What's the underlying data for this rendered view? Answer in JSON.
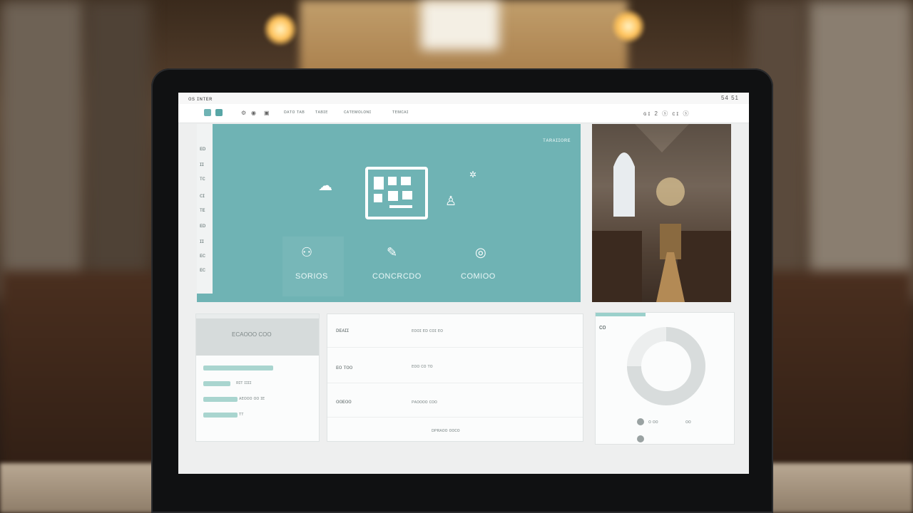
{
  "titlebar": {
    "title": "os ɪɴᴛᴇʀ",
    "right": "54 51"
  },
  "nav": {
    "links": [
      "ᴅᴀᴛᴏ ᴛᴀʙ",
      "ᴛᴀʙɪᴇ",
      "ᴄᴀᴛᴇᴍᴏʟᴏɴɪ",
      "ᴛᴇᴍᴄᴀɪ"
    ],
    "right_icons": "ɢɪ  2  ⓢ  ᴄɪ  ⓢ"
  },
  "hero": {
    "corner_label": "ᴛᴀʀᴀɪɪᴏʀᴇ",
    "side_items": [
      "ᴇᴅ",
      "ɪɪ",
      "ᴛᴄ",
      "ᴄɪ",
      "ᴛᴇ",
      "ᴇᴅ",
      "ɪɪ",
      "ᴇᴄ",
      "ᴇᴄ"
    ],
    "tiles": [
      {
        "label": "SORIOS",
        "icon": "users-icon"
      },
      {
        "label": "CONCRCDO",
        "icon": "chat-icon"
      },
      {
        "label": "COMIOO",
        "icon": "clock-icon"
      }
    ]
  },
  "card1": {
    "header": "ECAOOO COO",
    "bars": [
      {
        "text": ""
      },
      {
        "text": "ʀɪᴛ ɪɪɪɪ"
      },
      {
        "text": "ᴀᴇᴏᴏᴏ  ᴏᴏ ɪᴇ"
      },
      {
        "text": "ᴛᴛ"
      }
    ]
  },
  "card2": {
    "rows": [
      {
        "left": "ᴅᴇᴀɪɪ",
        "right": "ᴇᴏᴏɪ ᴇᴅ ᴄᴏɪ ᴇᴏ"
      },
      {
        "left": "ᴇᴏ ᴛᴏᴏ",
        "right": "ᴇᴏᴏ ᴄᴏ ᴛᴏ"
      },
      {
        "left": "ᴏᴏᴇᴏᴏ",
        "right": "ᴘᴀᴏᴏᴏᴏ ᴄᴏᴏ"
      }
    ],
    "footer": "ᴅᴘʀᴀᴏᴏ ᴏᴏᴄᴏ"
  },
  "card3": {
    "badge": "ᴄᴏ",
    "legend": [
      "ᴏ ᴏᴏ",
      "ᴏᴏ"
    ],
    "donut_fill": 0.75
  }
}
